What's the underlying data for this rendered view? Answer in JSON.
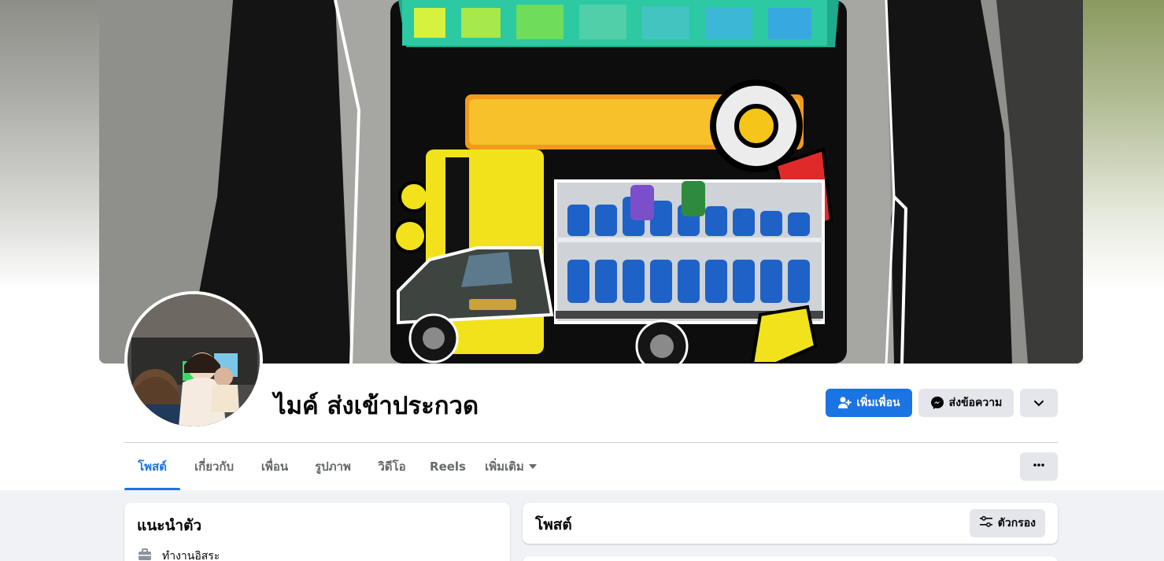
{
  "profile": {
    "name": "ไมค์ ส่งเข้าประกวด"
  },
  "actions": {
    "add_friend": "เพิ่มเพื่อน",
    "message": "ส่งข้อความ"
  },
  "tabs": [
    {
      "label": "โพสต์",
      "active": true
    },
    {
      "label": "เกี่ยวกับ",
      "active": false
    },
    {
      "label": "เพื่อน",
      "active": false
    },
    {
      "label": "รูปภาพ",
      "active": false
    },
    {
      "label": "วิดีโอ",
      "active": false
    },
    {
      "label": "Reels",
      "active": false
    },
    {
      "label": "เพิ่มเติม",
      "active": false
    }
  ],
  "intro": {
    "title": "แนะนำตัว",
    "work": "ทำงานอิสระ"
  },
  "posts": {
    "title": "โพสต์",
    "filter": "ตัวกรอง"
  },
  "colors": {
    "accent": "#1b74e4",
    "secondary_button": "#e4e6eb",
    "background": "#f0f2f5"
  },
  "icons": {
    "add_friend": "add-person-icon",
    "message": "messenger-icon",
    "expand": "chevron-down-icon",
    "more": "more-dots-icon",
    "filter": "filter-sliders-icon",
    "work": "briefcase-icon"
  }
}
